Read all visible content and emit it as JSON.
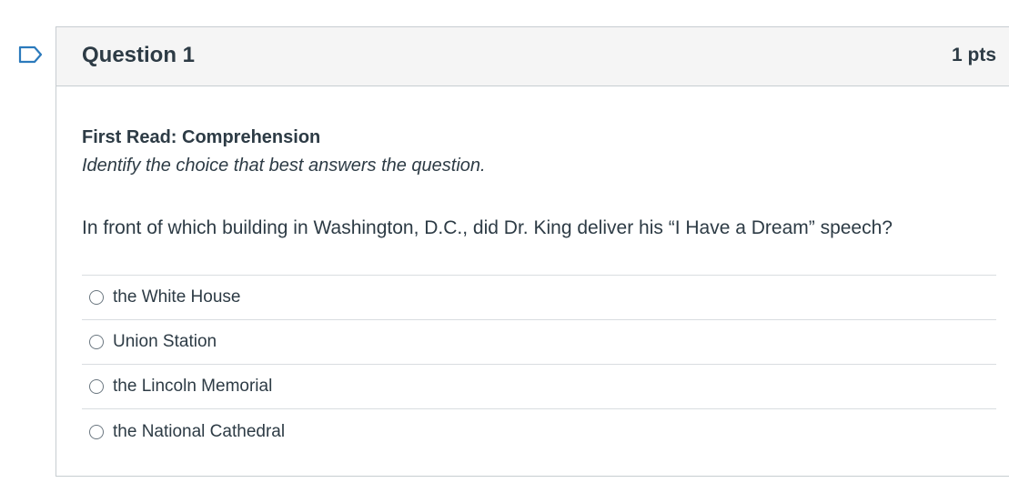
{
  "question": {
    "title": "Question 1",
    "points": "1 pts",
    "section_title": "First Read: Comprehension",
    "instructions": "Identify the choice that best answers the question.",
    "prompt": "In front of which building in Washington, D.C., did Dr. King deliver his “I Have a Dream” speech?",
    "answers": [
      {
        "label": "the White House",
        "selected": false
      },
      {
        "label": "Union Station",
        "selected": false
      },
      {
        "label": "the Lincoln Memorial",
        "selected": false
      },
      {
        "label": "the National Cathedral",
        "selected": false
      }
    ]
  },
  "icons": {
    "flag": "flag-outline-icon",
    "radio": "radio-unchecked-icon"
  },
  "colors": {
    "accent": "#2b7abc",
    "text": "#2d3b45",
    "header_bg": "#f5f5f5",
    "border": "#c7cdd1"
  }
}
